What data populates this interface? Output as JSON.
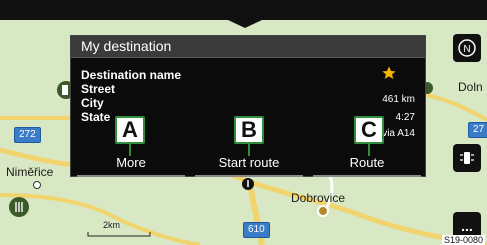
{
  "panel": {
    "title": "My destination",
    "destination_name": "Destination name",
    "street": "Street",
    "city": "City",
    "state": "State",
    "distance": "461 km",
    "time": "4:27",
    "via": "via A14",
    "favorite_icon": "star-icon",
    "favorite_color": "#f4b400"
  },
  "actions": {
    "more": "More",
    "start_route": "Start route",
    "route": "Route"
  },
  "callouts": {
    "a": "A",
    "b": "B",
    "c": "C"
  },
  "map": {
    "place_nimerice": "Niměřice",
    "place_dobrovice": "Dobrovice",
    "place_doln": "Doln",
    "road_272": "272",
    "road_27": "27",
    "road_610": "610",
    "scale": "2km",
    "bg_color": "#d9e8c4",
    "road_color": "#f2d46f"
  },
  "controls": {
    "compass_icon": "compass-north-icon",
    "compass_letter": "N",
    "lane_icon": "lane-assist-icon",
    "menu_icon": "more-dots-icon",
    "menu_label": "..."
  },
  "figure_code": "S19-0080"
}
